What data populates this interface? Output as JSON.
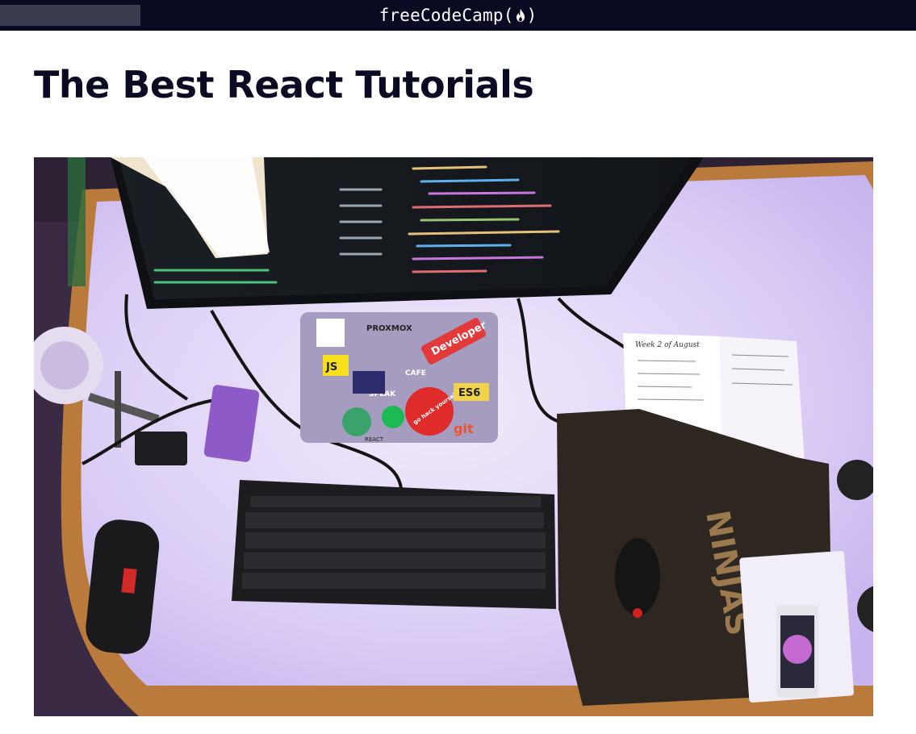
{
  "header": {
    "brand_prefix": "freeCodeCamp(",
    "brand_suffix": ")",
    "brand_icon": "flame-icon"
  },
  "article": {
    "title": "The Best React Tutorials"
  },
  "hero_image": {
    "stickers": {
      "developer": "Developer",
      "gohack": "go hack yourself.",
      "es6": "ES6",
      "git": "git",
      "js": "JS",
      "proxmox": "PROXMOX",
      "cafe": "CAFE",
      "react": "REACT",
      "speak": "SPEAK"
    },
    "notebook_heading": "Week 2 of August",
    "mousepad_text": "NINJAS"
  },
  "colors": {
    "topbar": "#0a0a23",
    "title": "#0a0a23",
    "desk_light": "#e9defa",
    "accent_purple": "#9b5de5"
  }
}
